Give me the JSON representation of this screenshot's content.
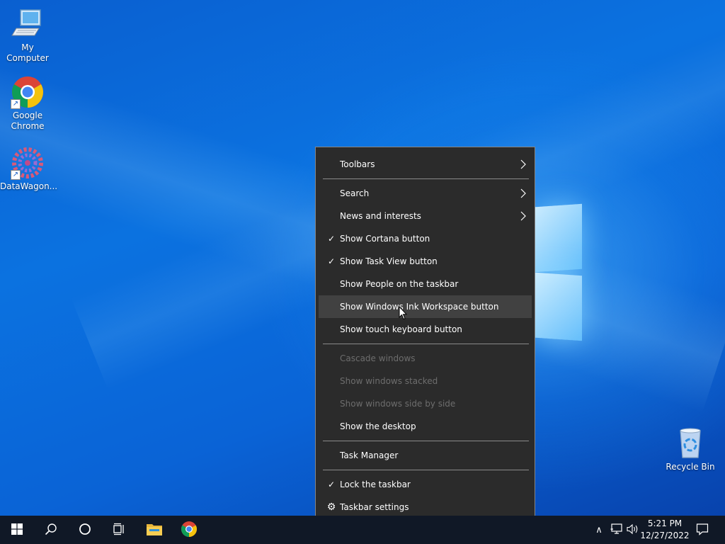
{
  "desktop": {
    "icons": [
      {
        "label": "My Computer",
        "icon": "computer-icon"
      },
      {
        "label": "Google Chrome",
        "icon": "chrome-icon"
      },
      {
        "label": "DataWagon...",
        "icon": "datawagon-icon"
      },
      {
        "label": "Recycle Bin",
        "icon": "recycle-bin-icon"
      }
    ]
  },
  "context_menu": {
    "items": [
      {
        "label": "Toolbars",
        "submenu": true
      },
      {
        "label": "Search",
        "submenu": true
      },
      {
        "label": "News and interests",
        "submenu": true
      },
      {
        "label": "Show Cortana button",
        "checked": true
      },
      {
        "label": "Show Task View button",
        "checked": true
      },
      {
        "label": "Show People on the taskbar"
      },
      {
        "label": "Show Windows Ink Workspace button",
        "highlighted": true
      },
      {
        "label": "Show touch keyboard button"
      },
      {
        "label": "Cascade windows",
        "disabled": true
      },
      {
        "label": "Show windows stacked",
        "disabled": true
      },
      {
        "label": "Show windows side by side",
        "disabled": true
      },
      {
        "label": "Show the desktop"
      },
      {
        "label": "Task Manager"
      },
      {
        "label": "Lock the taskbar",
        "checked": true
      },
      {
        "label": "Taskbar settings",
        "icon": "gear-icon"
      }
    ],
    "check_glyph": "✓",
    "arrow_glyph": "›",
    "gear_glyph": "⚙"
  },
  "taskbar": {
    "buttons": [
      "start-icon",
      "search-icon",
      "cortana-icon",
      "task-view-icon",
      "file-explorer-icon",
      "chrome-icon"
    ],
    "tray": {
      "chevron": "∧",
      "icons": [
        "network-icon",
        "volume-icon"
      ],
      "time": "5:21 PM",
      "date": "12/27/2022",
      "notification_icon": "action-center-icon"
    }
  },
  "colors": {
    "menu_bg": "#2b2b2b",
    "menu_highlight": "#414141",
    "taskbar_bg": "#101826",
    "desktop_blue": "#0b72e0"
  }
}
